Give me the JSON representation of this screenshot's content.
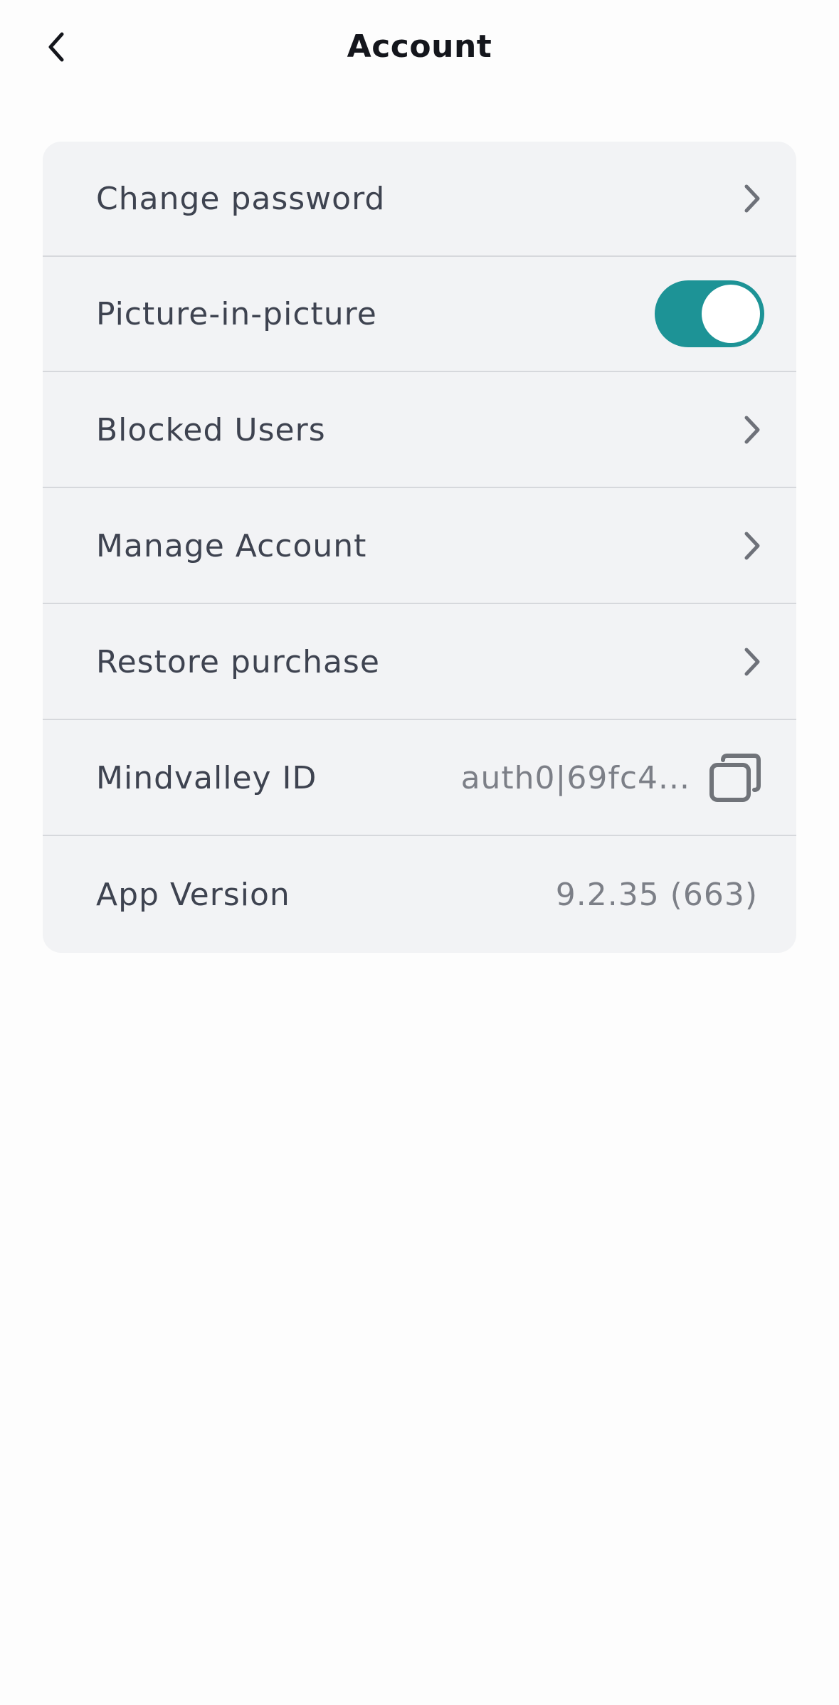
{
  "header": {
    "title": "Account",
    "back_icon": "chevron-left-icon"
  },
  "settings": {
    "change_password": {
      "label": "Change password"
    },
    "picture_in_picture": {
      "label": "Picture-in-picture",
      "enabled": true
    },
    "blocked_users": {
      "label": "Blocked Users"
    },
    "manage_account": {
      "label": "Manage Account"
    },
    "restore_purchase": {
      "label": "Restore purchase"
    },
    "mindvalley_id": {
      "label": "Mindvalley ID",
      "value": "auth0|69fc4...",
      "copy_icon": "copy-icon"
    },
    "app_version": {
      "label": "App Version",
      "value": "9.2.35 (663)"
    }
  },
  "colors": {
    "accent": "#1d9396",
    "card_background": "#f2f3f5",
    "label_text": "#3e4350",
    "value_text": "#7c7f87"
  }
}
